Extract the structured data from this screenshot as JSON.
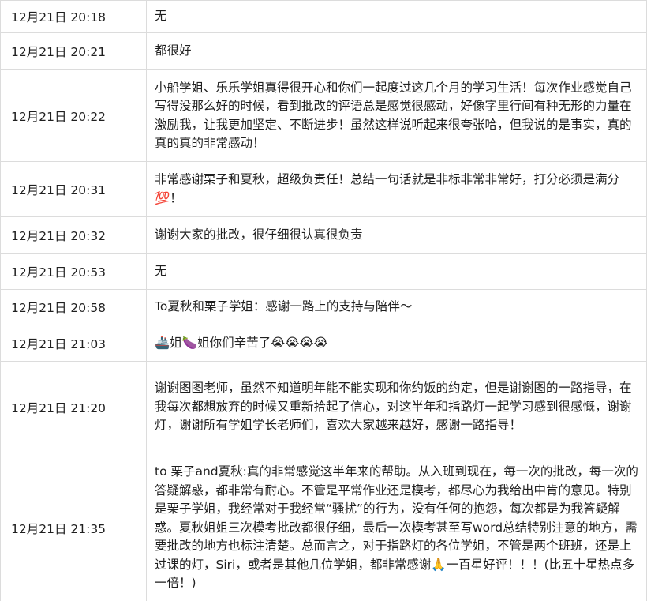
{
  "rows": [
    {
      "time": "12月21日 20:18",
      "message": "无"
    },
    {
      "time": "12月21日 20:21",
      "message": "都很好"
    },
    {
      "time": "12月21日 20:22",
      "message": "小船学姐、乐乐学姐真得很开心和你们一起度过这几个月的学习生活！每次作业感觉自己写得没那么好的时候，看到批改的评语总是感觉很感动，好像字里行间有种无形的力量在激励我，让我更加坚定、不断进步！虽然这样说听起来很夸张哈，但我说的是事实，真的真的真的非常感动！"
    },
    {
      "time": "12月21日 20:31",
      "message": "非常感谢栗子和夏秋，超级负责任！总结一句话就是非标非常非常好，打分必须是满分💯！"
    },
    {
      "time": "12月21日 20:32",
      "message": "谢谢大家的批改，很仔细很认真很负责"
    },
    {
      "time": "12月21日 20:53",
      "message": "无"
    },
    {
      "time": "12月21日 20:58",
      "message": "To夏秋和栗子学姐：感谢一路上的支持与陪伴～"
    },
    {
      "time": "12月21日 21:03",
      "message": "🚢姐🍆姐你们辛苦了😭😭😭😭"
    },
    {
      "time": "12月21日 21:20",
      "message": "谢谢图图老师，虽然不知道明年能不能实现和你约饭的约定，但是谢谢图的一路指导，在我每次都想放弃的时候又重新拾起了信心，对这半年和指路灯一起学习感到很感慨，谢谢灯，谢谢所有学姐学长老师们，喜欢大家越来越好，感谢一路指导！"
    },
    {
      "time": "12月21日 21:35",
      "message": "to 栗子and夏秋:真的非常感觉这半年来的帮助。从入班到现在，每一次的批改，每一次的答疑解惑，都非常有耐心。不管是平常作业还是模考，都尽心为我给出中肯的意见。特别是栗子学姐，我经常对于我经常“骚扰”的行为，没有任何的抱怨，每次都是为我答疑解惑。夏秋姐姐三次模考批改都很仔细，最后一次模考甚至写word总结特别注意的地方，需要批改的地方也标注清楚。总而言之，对于指路灯的各位学姐，不管是两个班班，还是上过课的灯，Siri，或者是其他几位学姐，都非常感谢🙏一百星好评！！！(比五十星热点多一倍！)"
    }
  ]
}
